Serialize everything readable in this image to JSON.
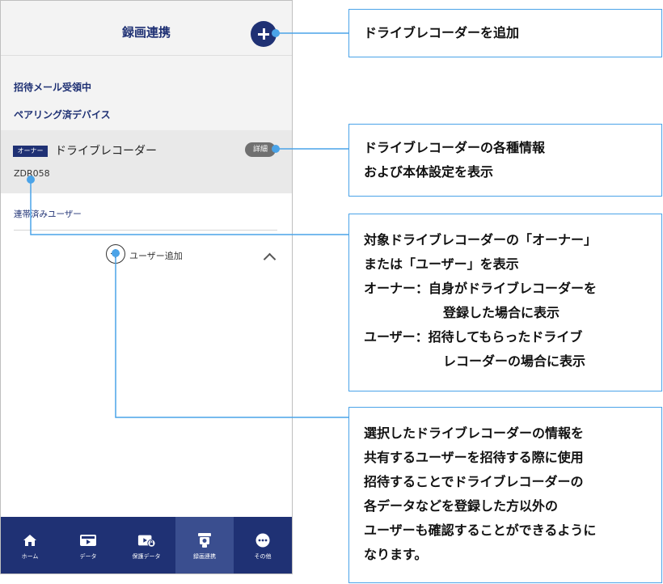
{
  "phone": {
    "header": {
      "title": "録画連携"
    },
    "sections": {
      "invite_received": "招待メール受領中",
      "paired_devices": "ペアリング済デバイス"
    },
    "device": {
      "owner_badge": "オーナー",
      "name": "ドライブレコーダー",
      "detail_label": "詳細",
      "id": "ZDR058"
    },
    "linked_users_label": "連帯済みユーザー",
    "add_user_label": "ユーザー追加",
    "nav": [
      {
        "label": "ホーム",
        "icon": "home-icon"
      },
      {
        "label": "データ",
        "icon": "data-icon"
      },
      {
        "label": "保護データ",
        "icon": "protected-data-icon"
      },
      {
        "label": "録画連携",
        "icon": "recording-link-icon",
        "active": true
      },
      {
        "label": "その他",
        "icon": "more-icon"
      }
    ]
  },
  "annotations": {
    "add_recorder": {
      "lines": [
        "ドライブレコーダーを追加"
      ]
    },
    "recorder_info": {
      "lines": [
        "ドライブレコーダーの各種情報",
        "および本体設定を表示"
      ]
    },
    "role": {
      "lines": [
        "対象ドライブレコーダーの「オーナー」",
        "または「ユーザー」を表示",
        "オーナー：自身がドライブレコーダーを",
        "登録した場合に表示",
        "ユーザー：招待してもらったドライブ",
        "レコーダーの場合に表示"
      ]
    },
    "invite": {
      "lines": [
        "選択したドライブレコーダーの情報を",
        "共有するユーザーを招待する際に使用",
        "招待することでドライブレコーダーの",
        "各データなどを登録した方以外の",
        "ユーザーも確認することができるように",
        "なります。"
      ]
    }
  },
  "colors": {
    "brand_navy": "#1f3174",
    "callout_blue": "#4aa3e8",
    "detail_gray": "#707070"
  }
}
